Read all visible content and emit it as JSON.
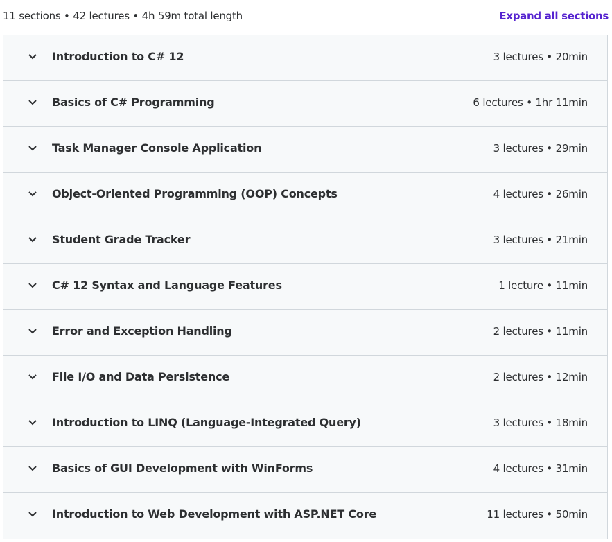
{
  "header": {
    "summary": "11 sections • 42 lectures • 4h 59m total length",
    "expand_all_label": "Expand all sections"
  },
  "sections": [
    {
      "title": "Introduction to C# 12",
      "meta": "3 lectures • 20min"
    },
    {
      "title": "Basics of C# Programming",
      "meta": "6 lectures • 1hr 11min"
    },
    {
      "title": "Task Manager Console Application",
      "meta": "3 lectures • 29min"
    },
    {
      "title": "Object-Oriented Programming (OOP) Concepts",
      "meta": "4 lectures • 26min"
    },
    {
      "title": "Student Grade Tracker",
      "meta": "3 lectures • 21min"
    },
    {
      "title": "C# 12 Syntax and Language Features",
      "meta": "1 lecture • 11min"
    },
    {
      "title": "Error and Exception Handling",
      "meta": "2 lectures • 11min"
    },
    {
      "title": "File I/O and Data Persistence",
      "meta": "2 lectures • 12min"
    },
    {
      "title": "Introduction to LINQ (Language-Integrated Query)",
      "meta": "3 lectures • 18min"
    },
    {
      "title": "Basics of GUI Development with WinForms",
      "meta": "4 lectures • 31min"
    },
    {
      "title": "Introduction to Web Development with ASP.NET Core",
      "meta": "11 lectures • 50min"
    }
  ],
  "icons": {
    "section_toggle": "chevron-down-icon"
  },
  "colors": {
    "accent": "#5624d0",
    "row_background": "#f7f9fa",
    "border": "#d1d7dc",
    "text": "#2d2f31"
  }
}
